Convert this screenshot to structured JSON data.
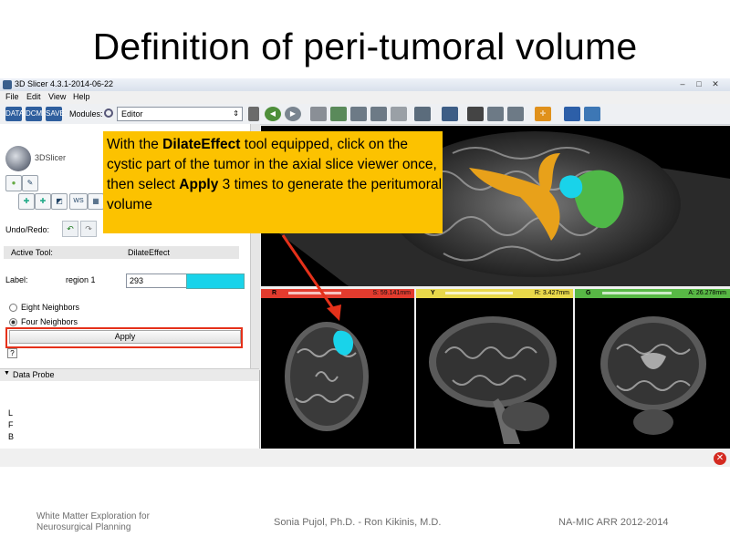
{
  "slide": {
    "title": "Definition of peri-tumoral volume",
    "footer_left_line1": "White Matter Exploration for",
    "footer_left_line2": "Neurosurgical Planning",
    "footer_center": "Sonia Pujol, Ph.D. - Ron Kikinis, M.D.",
    "footer_right": "NA-MIC ARR 2012-2014"
  },
  "window": {
    "title": "3D Slicer 4.3.1-2014-06-22",
    "controls": [
      "–",
      "□",
      "✕"
    ]
  },
  "menubar": [
    "File",
    "Edit",
    "View",
    "Help"
  ],
  "toolbar": {
    "buttons": [
      "DATA",
      "DCM",
      "SAVE"
    ],
    "modules_label": "Modules:",
    "module_selected": "Editor"
  },
  "editor_panel": {
    "logo_text": "3DSlicer",
    "undo_redo_label": "Undo/Redo:",
    "active_tool_label": "Active Tool:",
    "active_tool_value": "DilateEffect",
    "label_caption": "Label:",
    "label_name": "region 1",
    "label_value": "293",
    "label_color": "#19d3ea",
    "neighbor_options": [
      "Eight Neighbors",
      "Four Neighbors"
    ],
    "neighbor_selected": "Four Neighbors",
    "apply_label": "Apply",
    "help_label": "?",
    "data_probe_label": "Data Probe",
    "probe_letters": [
      "L",
      "F",
      "B"
    ]
  },
  "slice_views": [
    {
      "name": "R",
      "offset": "S: 59.141mm",
      "color": "#e33b2e"
    },
    {
      "name": "Y",
      "offset": "R: 3.427mm",
      "color": "#e8d84a"
    },
    {
      "name": "G",
      "offset": "A: 26.278mm",
      "color": "#58b845"
    }
  ],
  "callout": {
    "part1": "With the ",
    "bold1": "DilateEffect",
    "part2": " tool equipped, click on the cystic part of the tumor in the axial slice viewer once, then select ",
    "bold2": "Apply",
    "part3": " 3 times to generate the peritumoral volume"
  },
  "colors": {
    "callout_bg": "#fcc200",
    "highlight_red": "#e5311a",
    "tumor_cyan": "#19d3ea",
    "tumor_green": "#4fb848",
    "ventricle_orange": "#e8a11a"
  }
}
